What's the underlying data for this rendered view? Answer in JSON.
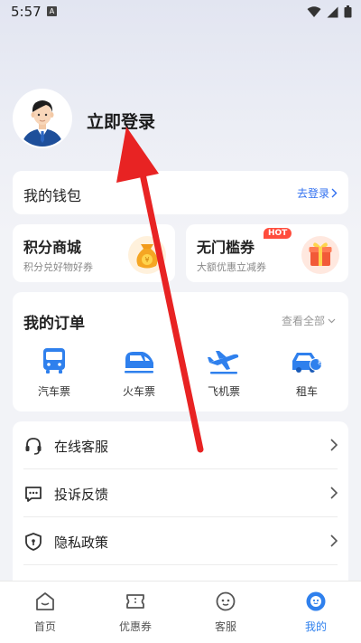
{
  "status_bar": {
    "time": "5:57",
    "notification_icon": "A"
  },
  "profile": {
    "login_label": "立即登录"
  },
  "wallet": {
    "title": "我的钱包",
    "link_label": "去登录"
  },
  "promos": [
    {
      "title": "积分商城",
      "subtitle": "积分兑好物好券",
      "icon": "money-bag-icon"
    },
    {
      "title": "无门槛券",
      "subtitle": "大额优惠立减券",
      "badge": "HOT",
      "icon": "gift-box-icon"
    }
  ],
  "orders": {
    "title": "我的订单",
    "view_all_label": "查看全部",
    "items": [
      {
        "label": "汽车票",
        "icon": "bus-icon"
      },
      {
        "label": "火车票",
        "icon": "train-icon"
      },
      {
        "label": "飞机票",
        "icon": "airplane-icon"
      },
      {
        "label": "租车",
        "icon": "rental-car-icon",
        "icon_text": "租"
      }
    ]
  },
  "menu": {
    "items": [
      {
        "label": "在线客服",
        "icon": "headset-icon"
      },
      {
        "label": "投诉反馈",
        "icon": "chat-bubble-icon"
      },
      {
        "label": "隐私政策",
        "icon": "shield-icon"
      }
    ]
  },
  "tabbar": {
    "items": [
      {
        "label": "首页",
        "icon": "home-icon",
        "active": false
      },
      {
        "label": "优惠券",
        "icon": "coupon-icon",
        "active": false
      },
      {
        "label": "客服",
        "icon": "service-face-icon",
        "active": false
      },
      {
        "label": "我的",
        "icon": "profile-icon",
        "active": true
      }
    ]
  },
  "colors": {
    "accent": "#2f80ed",
    "link": "#2f6ff0",
    "hot_badge": "#ff4d3d",
    "annotation_arrow": "#e82323",
    "page_background": "#f2f3f7"
  }
}
